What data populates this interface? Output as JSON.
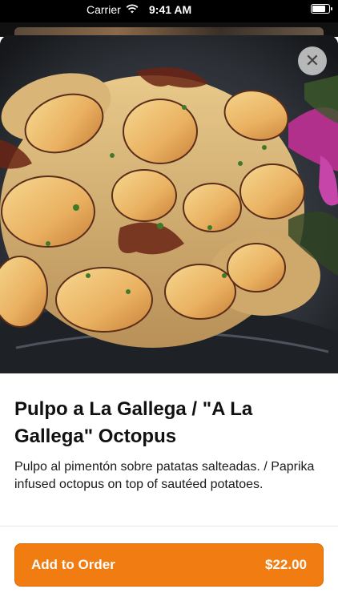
{
  "status_bar": {
    "carrier": "Carrier",
    "time": "9:41 AM",
    "battery_level": 0.9
  },
  "icons": {
    "wifi": "wifi-icon",
    "close": "close-icon"
  },
  "item": {
    "title": "Pulpo a La Gallega / \"A La Gallega\" Octopus",
    "description": "Pulpo al pimentón sobre patatas salteadas. / Paprika infused octopus on top of sautéed potatoes."
  },
  "order_button": {
    "label": "Add to Order",
    "price": "$22.00",
    "color": "#f07c12"
  }
}
